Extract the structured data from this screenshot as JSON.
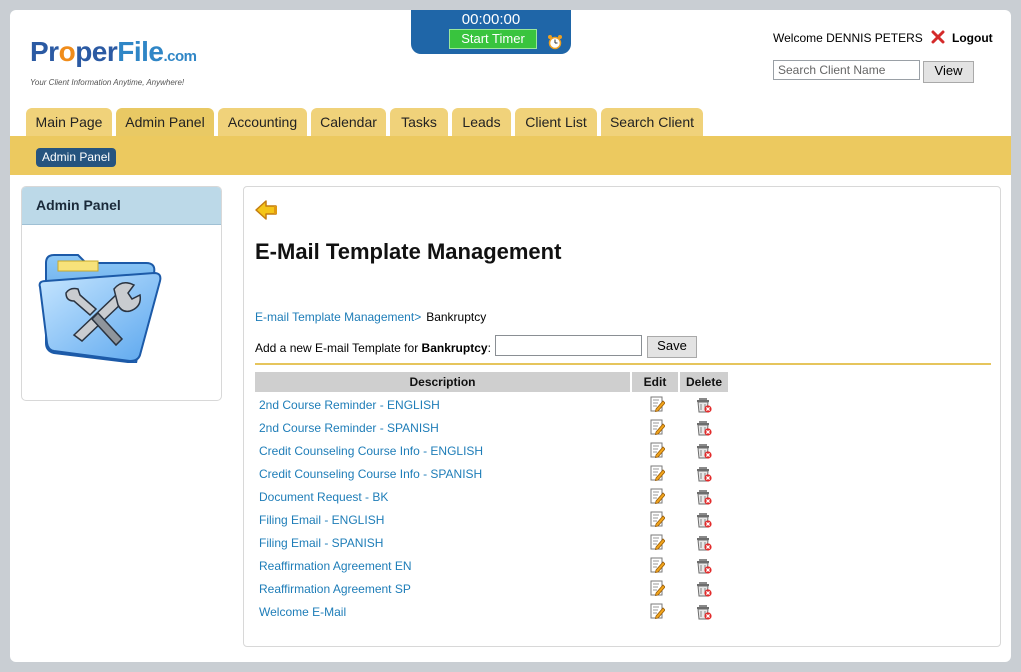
{
  "logo": {
    "part1": "Pr",
    "part_o": "o",
    "part2": "per",
    "part3": "File",
    "suffix": ".com",
    "tagline": "Your Client Information Anytime, Anywhere!"
  },
  "timer": {
    "value": "00:00:00",
    "button": "Start Timer",
    "icon": "alarm-clock-icon"
  },
  "header": {
    "welcome": "Welcome DENNIS PETERS",
    "logout": "Logout",
    "search_placeholder": "Search Client Name",
    "view_label": "View"
  },
  "tabs": [
    {
      "label": "Main Page"
    },
    {
      "label": "Admin Panel"
    },
    {
      "label": "Accounting"
    },
    {
      "label": "Calendar"
    },
    {
      "label": "Tasks"
    },
    {
      "label": "Leads"
    },
    {
      "label": "Client List"
    },
    {
      "label": "Search Client"
    }
  ],
  "subnav": {
    "active": "Admin Panel"
  },
  "sidebar": {
    "title": "Admin Panel",
    "icon": "tools-folder-icon"
  },
  "main": {
    "title": "E-Mail Template Management",
    "breadcrumb_link": "E-mail Template Management>",
    "breadcrumb_current": "Bankruptcy",
    "add_prefix": "Add a new E-mail Template for ",
    "add_category": "Bankruptcy",
    "add_suffix": ":",
    "save_label": "Save",
    "columns": {
      "description": "Description",
      "edit": "Edit",
      "delete": "Delete"
    },
    "templates": [
      "2nd Course Reminder - ENGLISH",
      "2nd Course Reminder - SPANISH",
      "Credit Counseling Course Info - ENGLISH",
      "Credit Counseling Course Info - SPANISH",
      "Document Request - BK",
      "Filing Email - ENGLISH",
      "Filing Email - SPANISH",
      "Reaffirmation Agreement EN",
      "Reaffirmation Agreement SP",
      "Welcome E-Mail"
    ]
  },
  "colors": {
    "tab": "#f0d27a",
    "bar": "#ecc95f",
    "link": "#1e7db8",
    "timer_bg": "#1f66a8",
    "timer_btn": "#39c43e",
    "pill": "#26547f"
  }
}
